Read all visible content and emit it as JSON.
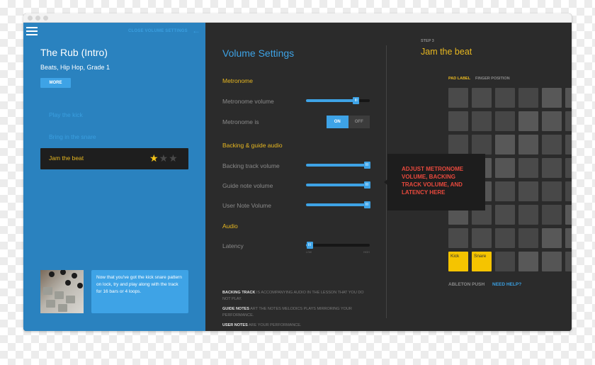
{
  "window": {
    "traffic_lights": [
      "close",
      "minimize",
      "maximize"
    ]
  },
  "left_panel": {
    "menu_icon": "hamburger-icon",
    "close_settings_label": "CLOSE VOLUME SETTINGS",
    "back_icon": "←",
    "lesson_title": "The Rub (Intro)",
    "lesson_meta": "Beats, Hip Hop, Grade 1",
    "more_label": "MORE",
    "steps": [
      {
        "label": "Play the kick"
      },
      {
        "label": "Bring in the snare"
      },
      {
        "label": "Jam the beat",
        "active": true,
        "stars_earned": 1,
        "stars_total": 3
      }
    ],
    "star_glyph": "★",
    "tip_text": "Now that you've got the kick snare pattern on lock, try and play along with the track for 16 bars or 4 loops."
  },
  "volume_settings": {
    "title": "Volume Settings",
    "sections": {
      "metronome": "Metronome",
      "backing": "Backing & guide audio",
      "audio": "Audio"
    },
    "metronome_volume": {
      "label": "Metronome volume",
      "value": 0.78
    },
    "metronome_is": {
      "label": "Metronome is",
      "on_label": "ON",
      "off_label": "OFF",
      "state": "on"
    },
    "backing_track_volume": {
      "label": "Backing track volume",
      "value": 0.95
    },
    "guide_note_volume": {
      "label": "Guide note volume",
      "value": 0.95
    },
    "user_note_volume": {
      "label": "User Note Volume",
      "value": 0.95
    },
    "latency": {
      "label": "Latency",
      "value": 0.05,
      "low_label": "LOW",
      "high_label": "HIGH"
    },
    "handle_glyph": "III",
    "notes": [
      {
        "term": "BACKING TRACK",
        "text": " IS ACCOMPANYING AUDIO IN THE LESSON THAT YOU DO NOT PLAY."
      },
      {
        "term": "GUIDE NOTES",
        "text": " ART THE NOTES MELODICS PLAYS MIRRORING YOUR PERFORMANCE."
      },
      {
        "term": "USER NOTES",
        "text": " ARE YOUR PERFORMANCE."
      }
    ]
  },
  "step_panel": {
    "step_number": "STEP 3",
    "title": "Jam the beat",
    "tabs": [
      {
        "label": "PAD LABEL",
        "active": true
      },
      {
        "label": "FINGER POSITION",
        "active": false
      }
    ],
    "pad_rows": [
      [
        "",
        "",
        "",
        "",
        "",
        ""
      ],
      [
        "",
        "",
        "",
        "",
        "",
        ""
      ],
      [
        "",
        "",
        "",
        "",
        "",
        ""
      ],
      [
        "",
        "",
        "",
        "",
        "",
        ""
      ],
      [
        "",
        "",
        "",
        "",
        "",
        ""
      ],
      [
        "",
        "",
        "",
        "",
        "",
        ""
      ],
      [
        "",
        "",
        "",
        "",
        "",
        ""
      ],
      [
        "Kick",
        "Snare",
        "",
        "",
        "",
        ""
      ]
    ],
    "highlighted_pads": [
      "Kick",
      "Snare"
    ],
    "device_label": "ABLETON PUSH",
    "help_label": "NEED HELP?",
    "callout": "ADJUST METRONOME VOLUME, BACKING TRACK VOLUME, AND LATENCY HERE"
  },
  "colors": {
    "left_bg": "#2a82bf",
    "accent_blue": "#3ea3e6",
    "accent_yellow": "#e8b820",
    "pad_yellow": "#f5c400",
    "callout_red": "#e8493d",
    "dark_bg": "#2b2b2b"
  }
}
